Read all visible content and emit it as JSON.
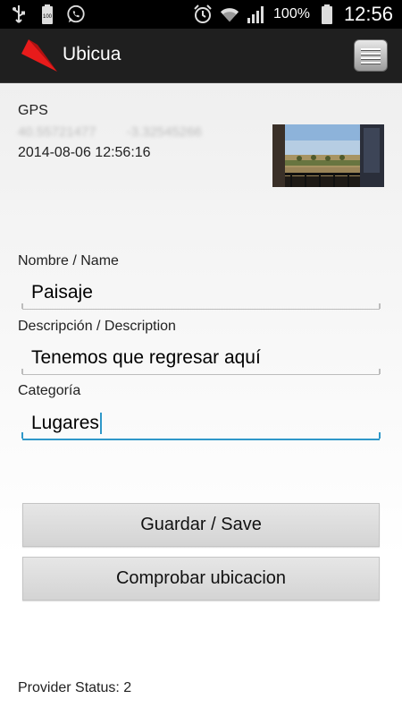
{
  "status_bar": {
    "battery_percent": "100%",
    "time": "12:56",
    "left_icons": [
      "usb-icon",
      "battery-100-icon",
      "whatsapp-icon"
    ],
    "right_icons": [
      "alarm-icon",
      "wifi-icon",
      "signal-icon",
      "battery-icon"
    ]
  },
  "action_bar": {
    "title": "Ubicua",
    "logo_color": "#e81b1b"
  },
  "gps": {
    "label": "GPS",
    "latitude": "40.55721477",
    "longitude": "-3.32545266",
    "timestamp": "2014-08-06 12:56:16"
  },
  "form": {
    "name_label": "Nombre / Name",
    "name_value": "Paisaje",
    "description_label": "Descripción / Description",
    "description_value": "Tenemos que regresar aquí",
    "category_label": "Categoría",
    "category_value": "Lugares"
  },
  "buttons": {
    "save_label": "Guardar / Save",
    "check_location_label": "Comprobar ubicacion"
  },
  "footer": {
    "provider_status": "Provider Status: 2"
  },
  "colors": {
    "accent": "#2f98c9",
    "action_bar_bg": "#1f1f1f",
    "status_bar_bg": "#000000"
  }
}
